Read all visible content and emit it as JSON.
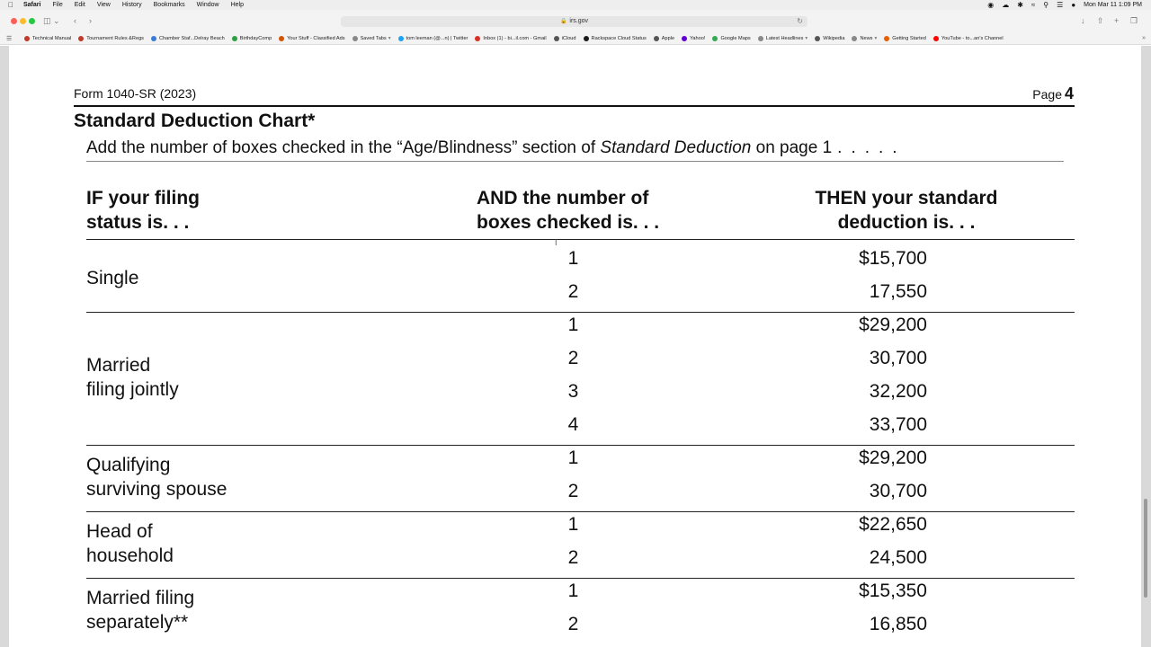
{
  "menubar": {
    "app": "Safari",
    "items": [
      "File",
      "Edit",
      "View",
      "History",
      "Bookmarks",
      "Window",
      "Help"
    ],
    "datetime": "Mon Mar 11  1:09 PM"
  },
  "browser": {
    "url": "irs.gov"
  },
  "bookmarks": [
    {
      "label": "Technical Manual",
      "color": "#c0392b"
    },
    {
      "label": "Tournament Rules &Regs",
      "color": "#c0392b"
    },
    {
      "label": "Chamber Staf...Delray Beach",
      "color": "#3a7bd5"
    },
    {
      "label": "BirthdayComp",
      "color": "#2e9e44"
    },
    {
      "label": "Your Stuff - Classified Ads",
      "color": "#d35400"
    },
    {
      "label": "Saved Tabs",
      "color": "#888888",
      "chevron": true
    },
    {
      "label": "tom leeman (@...n) | Twitter",
      "color": "#1da1f2"
    },
    {
      "label": "Inbox (1) - bi...il.com - Gmail",
      "color": "#d93025"
    },
    {
      "label": "iCloud",
      "color": "#555555"
    },
    {
      "label": "Rackspace Cloud Status",
      "color": "#1a1a1a"
    },
    {
      "label": "Apple",
      "color": "#555555"
    },
    {
      "label": "Yahoo!",
      "color": "#6001d2"
    },
    {
      "label": "Google Maps",
      "color": "#34a853"
    },
    {
      "label": "Latest Headlines",
      "color": "#888888",
      "chevron": true
    },
    {
      "label": "Wikipedia",
      "color": "#555555"
    },
    {
      "label": "News",
      "color": "#888888",
      "chevron": true
    },
    {
      "label": "Getting Started",
      "color": "#e66000"
    },
    {
      "label": "YouTube - to...an's Channel",
      "color": "#ff0000"
    }
  ],
  "document": {
    "form_id": "Form 1040-SR (2023)",
    "page_label": "Page",
    "page_number": "4",
    "chart_title": "Standard Deduction Chart*",
    "instruction_pre": "Add the number of boxes checked in the “Age/Blindness” section of ",
    "instruction_italic": "Standard Deduction",
    "instruction_post": " on page 1",
    "instruction_dots": ".....",
    "headers": {
      "col1_line1": "IF your filing",
      "col1_line2": "status is. . .",
      "col2_line1": "AND the number of",
      "col2_line2": "boxes checked is. . .",
      "col3_line1": "THEN your standard",
      "col3_line2": "deduction is. . ."
    },
    "groups": [
      {
        "status_line1": "Single",
        "status_line2": "",
        "rows": [
          {
            "boxes": "1",
            "amount": "$15,700"
          },
          {
            "boxes": "2",
            "amount": "17,550"
          }
        ]
      },
      {
        "status_line1": "Married",
        "status_line2": "filing jointly",
        "rows": [
          {
            "boxes": "1",
            "amount": "$29,200"
          },
          {
            "boxes": "2",
            "amount": "30,700"
          },
          {
            "boxes": "3",
            "amount": "32,200"
          },
          {
            "boxes": "4",
            "amount": "33,700"
          }
        ]
      },
      {
        "status_line1": "Qualifying",
        "status_line2": "surviving spouse",
        "rows": [
          {
            "boxes": "1",
            "amount": "$29,200"
          },
          {
            "boxes": "2",
            "amount": "30,700"
          }
        ]
      },
      {
        "status_line1": "Head of",
        "status_line2": "household",
        "rows": [
          {
            "boxes": "1",
            "amount": "$22,650"
          },
          {
            "boxes": "2",
            "amount": "24,500"
          }
        ]
      },
      {
        "status_line1": "Married filing",
        "status_line2": "separately**",
        "rows": [
          {
            "boxes": "1",
            "amount": "$15,350"
          },
          {
            "boxes": "2",
            "amount": "16,850"
          }
        ]
      }
    ]
  }
}
